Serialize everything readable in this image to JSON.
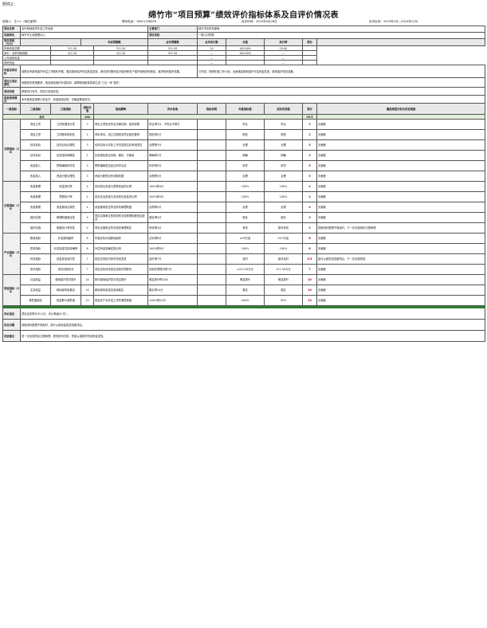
{
  "header": {
    "attachment": "附件2：",
    "title": "绵竹市“项目预算”绩效评价指标体系及自评价情况表",
    "unit_label": "填报人：王××（单位盖章）",
    "contact_label": "联系电话：18821166858",
    "date_label": "自评时间：2025年4月28日",
    "period_label": "自评区间：2024年1月—2024年12月"
  },
  "basic": {
    "project_name_label": "项目名称",
    "project_name": "全市耕地保护补偿工作经费",
    "department_label": "主管部门",
    "department": "绵竹市自然资源局",
    "impl_unit_label": "实施单位",
    "impl_unit": "绵竹市土地整理中心",
    "category_label": "项目类别",
    "category": "一般公共预算",
    "budget_label": "项目资金（万元）",
    "budget_cols": [
      "年初预算数",
      "全年预算数",
      "全年执行数",
      "分值",
      "执行率",
      "得分"
    ],
    "budget_rows": [
      {
        "name": "年度资金总额",
        "values": [
          "311.50",
          "311.50",
          "311.50",
          "10",
          "100.00%",
          "10.00"
        ]
      },
      {
        "name": "其中：当年财政拨款",
        "values": [
          "311.50",
          "311.50",
          "311.50",
          "—",
          "100.00%",
          "—"
        ]
      },
      {
        "name": "上年结转资金",
        "values": [
          "",
          "",
          "",
          "—",
          "",
          "—"
        ]
      },
      {
        "name": "其他资金",
        "values": [
          "",
          "",
          "",
          "—",
          "",
          "—"
        ]
      }
    ],
    "goal_label": "年度总体目标",
    "goal_plan": "保障全市耕地保护补偿工作顺利开展，落实耕地保护补偿资金发放，调动农村集体经济组织和农户保护耕地的积极性，维护耕地保护成果。",
    "goal_done": "已完成，按照年度工作计划，全面落实耕地保护补偿资金发放，耕地保护成效显著。",
    "necessity_label": "项目立项必要性",
    "necessity": "依据相关政策要求，落实耕地保护补偿机制，保障耕地数量质量生态“三位一体”保护。",
    "stage_label": "项目阶段",
    "stage": "预算执行完毕，项目已实施完成。",
    "funding_label": "资金使用情况",
    "funding": "本年度资金按照计划支付，资金使用合规，无截留挪用情况。"
  },
  "indicators": {
    "headers": [
      "一级指标",
      "二级指标",
      "三级指标",
      "指标分值",
      "指标解释",
      "评价标准",
      "指标说明",
      "年度指标值",
      "实际完成值",
      "得分",
      "偏差原因分析及改进措施"
    ],
    "total_label": "合计",
    "total_score": "100",
    "total_got": "95.5",
    "groups": [
      {
        "lvl1": "决策指标（20）",
        "rows": [
          {
            "lvl2": "项目立项",
            "lvl3": "立项依据充分性",
            "score": "3",
            "explain": "项目立项是否符合法律法规、相关政策",
            "std": "符合得3分，不符合不得分",
            "target": "符合",
            "actual": "符合",
            "got": "3",
            "note": "无偏差"
          },
          {
            "lvl2": "项目立项",
            "lvl3": "立项程序规范性",
            "score": "2",
            "explain": "项目申请、设立过程是否符合相关要求",
            "std": "规范得2分",
            "target": "规范",
            "actual": "规范",
            "got": "2",
            "note": "无偏差"
          },
          {
            "lvl2": "绩效目标",
            "lvl3": "绩效目标合理性",
            "score": "3",
            "explain": "绩效目标与实际工作内容是否具有相关性",
            "std": "合理得3分",
            "target": "合理",
            "actual": "合理",
            "got": "3",
            "note": "无偏差"
          },
          {
            "lvl2": "绩效目标",
            "lvl3": "绩效指标明确性",
            "score": "2",
            "explain": "绩效指标是否清晰、细化、可衡量",
            "std": "明确得2分",
            "target": "明确",
            "actual": "明确",
            "got": "2",
            "note": "无偏差"
          },
          {
            "lvl2": "资金投入",
            "lvl3": "预算编制科学性",
            "score": "5",
            "explain": "预算编制是否经过科学论证",
            "std": "科学得5分",
            "target": "科学",
            "actual": "科学",
            "got": "5",
            "note": "无偏差"
          },
          {
            "lvl2": "资金投入",
            "lvl3": "资金分配合理性",
            "score": "5",
            "explain": "资金分配是否有测算依据",
            "std": "合理得5分",
            "target": "合理",
            "actual": "合理",
            "got": "5",
            "note": "无偏差"
          }
        ]
      },
      {
        "lvl1": "过程指标（20）",
        "rows": [
          {
            "lvl2": "资金管理",
            "lvl3": "资金到位率",
            "score": "4",
            "explain": "实际到位资金与预算资金的比率",
            "std": "100%得4分",
            "target": "100%",
            "actual": "100%",
            "got": "4",
            "note": "无偏差"
          },
          {
            "lvl2": "资金管理",
            "lvl3": "预算执行率",
            "score": "4",
            "explain": "实际支出资金与实际到位资金的比率",
            "std": "100%得4分",
            "target": "100%",
            "actual": "100%",
            "got": "4",
            "note": "无偏差"
          },
          {
            "lvl2": "资金管理",
            "lvl3": "资金使用合规性",
            "score": "4",
            "explain": "资金使用是否符合财务管理制度",
            "std": "合规得4分",
            "target": "合规",
            "actual": "合规",
            "got": "4",
            "note": "无偏差"
          },
          {
            "lvl2": "组织实施",
            "lvl3": "管理制度健全性",
            "score": "4",
            "explain": "项目实施单位的财务和业务管理制度是否健全",
            "std": "健全得4分",
            "target": "健全",
            "actual": "健全",
            "got": "4",
            "note": "无偏差"
          },
          {
            "lvl2": "组织实施",
            "lvl3": "制度执行有效性",
            "score": "4",
            "explain": "项目实施是否符合相关管理规定",
            "std": "有效得4分",
            "target": "有效",
            "actual": "基本有效",
            "got": "3",
            "note": "档案资料整理不够及时，下一步加强资料归档管理"
          }
        ]
      },
      {
        "lvl1": "产出指标（30）",
        "rows": [
          {
            "lvl2": "数量指标",
            "lvl3": "补偿耕地面积",
            "score": "8",
            "explain": "年度实际补偿耕地面积",
            "std": "达标得8分",
            "target": "≥29万亩",
            "actual": "29.3万亩",
            "got": "8",
            "note": "无偏差"
          },
          {
            "lvl2": "质量指标",
            "lvl3": "补偿资金发放准确率",
            "score": "8",
            "explain": "补偿资金准确发放比例",
            "std": "100%得8分",
            "target": "100%",
            "actual": "100%",
            "got": "8",
            "note": "无偏差"
          },
          {
            "lvl2": "时效指标",
            "lvl3": "资金发放及时性",
            "score": "7",
            "explain": "是否在规定时间内完成发放",
            "std": "及时得7分",
            "target": "及时",
            "actual": "基本及时",
            "got": "5.5",
            "note": "部分乡镇发放进度滞后，下一步加强督促"
          },
          {
            "lvl2": "成本指标",
            "lvl3": "成本控制情况",
            "score": "7",
            "explain": "项目实际成本是否控制在预算内",
            "std": "控制在预算内得7分",
            "target": "≤311.50万元",
            "actual": "311.50万元",
            "got": "7",
            "note": "无偏差"
          }
        ]
      },
      {
        "lvl1": "效益指标（30）",
        "rows": [
          {
            "lvl2": "社会效益",
            "lvl3": "耕地保护意识提升",
            "score": "10",
            "explain": "群众耕地保护意识是否提升",
            "std": "明显提升得10分",
            "target": "明显提升",
            "actual": "明显提升",
            "got": "10",
            "note": "无偏差"
          },
          {
            "lvl2": "生态效益",
            "lvl3": "耕地保有量稳定",
            "score": "10",
            "explain": "耕地保有量是否保持稳定",
            "std": "稳定得10分",
            "target": "稳定",
            "actual": "稳定",
            "got": "10",
            "note": "无偏差"
          },
          {
            "lvl2": "满意度指标",
            "lvl3": "受益群众满意度",
            "score": "10",
            "explain": "受益农户对补偿工作的满意程度",
            "std": "≥90%得10分",
            "target": "≥90%",
            "actual": "92%",
            "got": "10",
            "note": "无偏差"
          }
        ]
      }
    ]
  },
  "footer": {
    "conclusion_label": "评价结论",
    "conclusion": "项目自评得分95.5分，评价等级为“优”。",
    "problems_label": "存在问题",
    "problems": "档案资料整理不够及时，部分乡镇资金发放进度滞后。",
    "suggest_label": "改进建议",
    "suggest": "进一步加强项目过程管理，规范资料归档，督促乡镇按时完成资金发放。"
  }
}
